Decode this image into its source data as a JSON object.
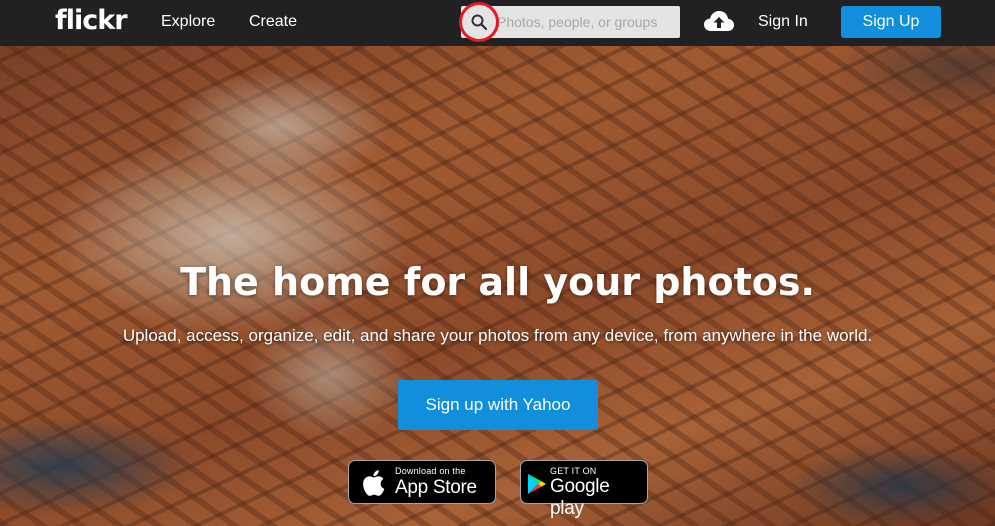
{
  "header": {
    "logo": "flickr",
    "nav": [
      {
        "label": "Explore"
      },
      {
        "label": "Create"
      }
    ],
    "search": {
      "placeholder": "Photos, people, or groups",
      "value": "",
      "icon": "search-icon"
    },
    "upload_icon": "cloud-upload-icon",
    "sign_in": "Sign In",
    "sign_up": "Sign Up"
  },
  "hero": {
    "title": "The home for all your photos.",
    "subtitle": "Upload, access, organize, edit, and share your photos from any device, from anywhere in the world.",
    "cta": "Sign up with Yahoo",
    "app_store": {
      "small": "Download on the",
      "big": "App Store",
      "icon": "apple-icon"
    },
    "google_play": {
      "small": "GET IT ON",
      "big": "Google play",
      "icon": "google-play-icon"
    }
  },
  "colors": {
    "topbar": "#212124",
    "accent_blue": "#128fdc",
    "highlight_ring": "#e6191e"
  }
}
